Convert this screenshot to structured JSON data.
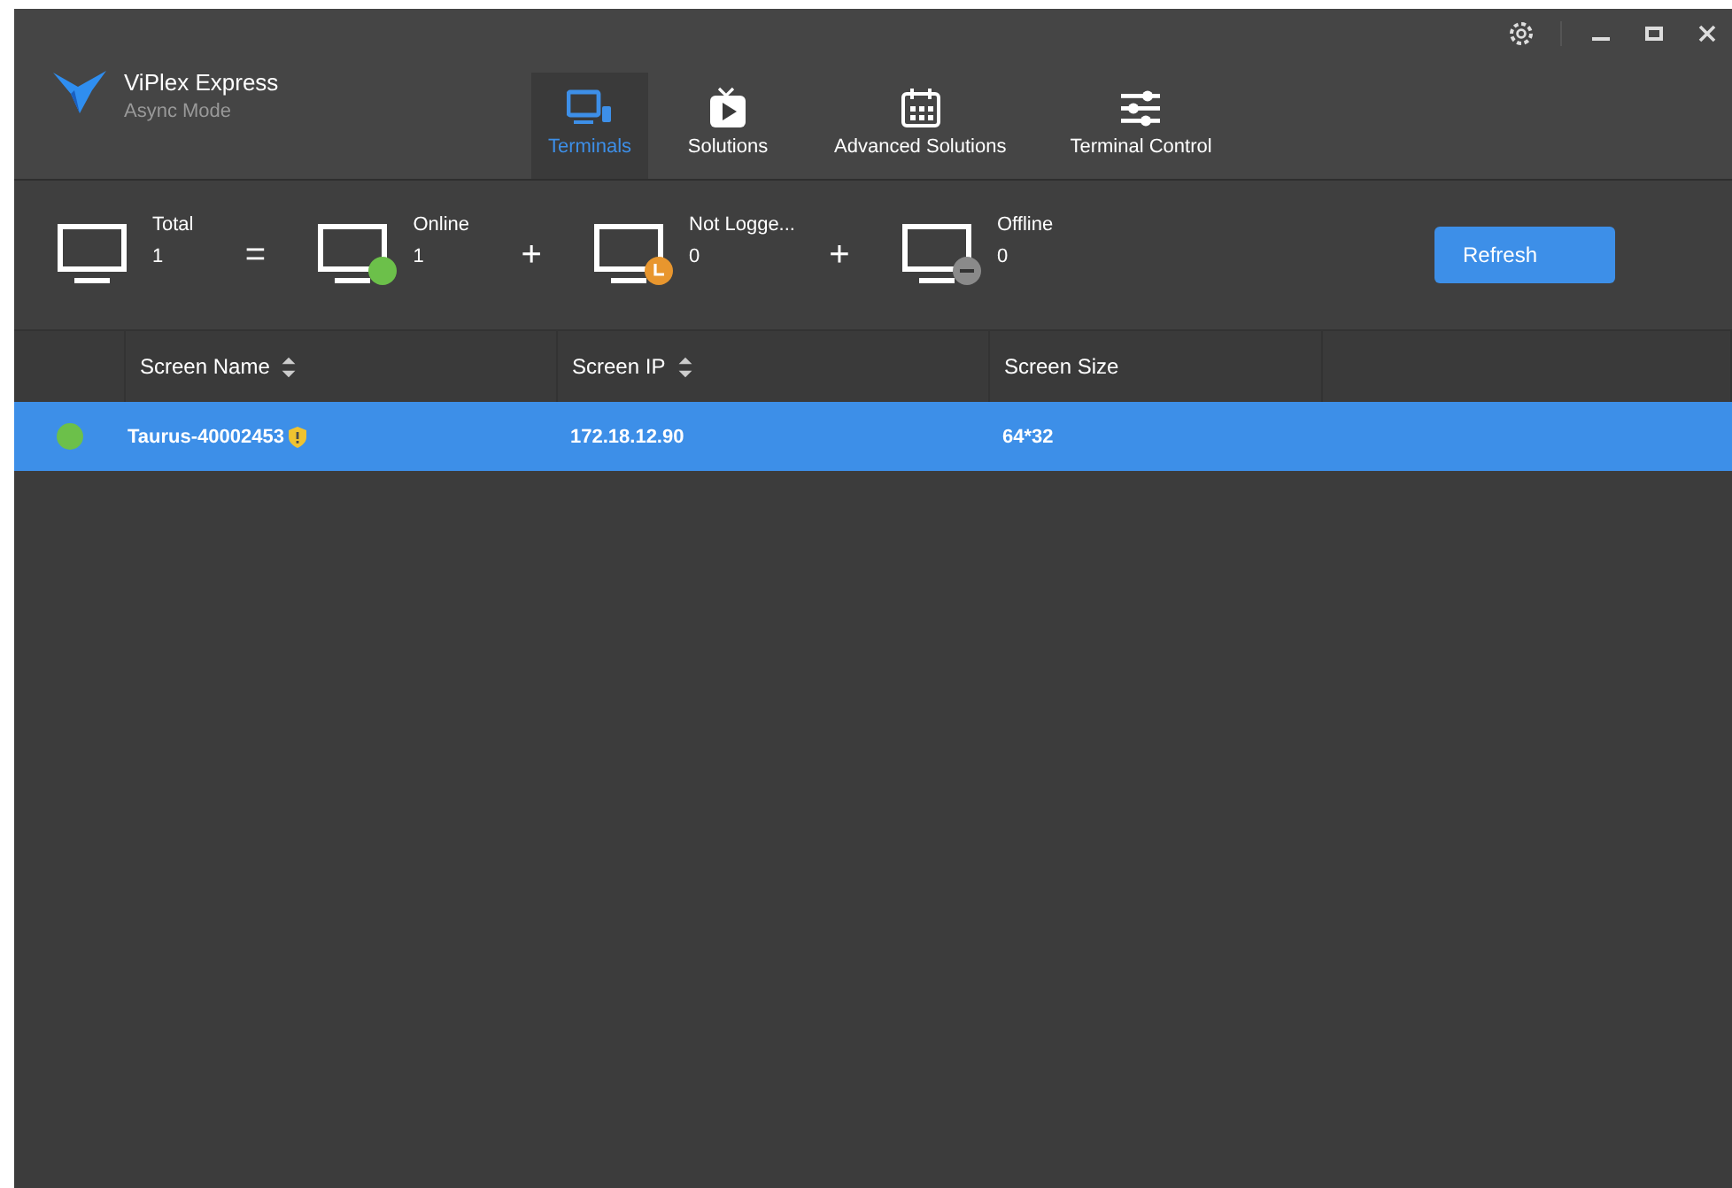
{
  "app": {
    "title": "ViPlex Express",
    "subtitle": "Async Mode"
  },
  "tabs": [
    {
      "label": "Terminals",
      "selected": true
    },
    {
      "label": "Solutions",
      "selected": false
    },
    {
      "label": "Advanced Solutions",
      "selected": false
    },
    {
      "label": "Terminal Control",
      "selected": false
    }
  ],
  "summary": [
    {
      "kind": "total",
      "label": "Total",
      "count": "1"
    },
    {
      "kind": "operator",
      "symbol": "="
    },
    {
      "kind": "online",
      "label": "Online",
      "count": "1"
    },
    {
      "kind": "operator",
      "symbol": "+"
    },
    {
      "kind": "pending",
      "label": "Not Logge...",
      "count": "0"
    },
    {
      "kind": "operator",
      "symbol": "+"
    },
    {
      "kind": "offline",
      "label": "Offline",
      "count": "0"
    }
  ],
  "refresh_button": {
    "label": "Refresh"
  },
  "table": {
    "columns": [
      {
        "label": "Screen Name",
        "sortable": true
      },
      {
        "label": "Screen IP",
        "sortable": true
      },
      {
        "label": "Screen Size",
        "sortable": false
      }
    ],
    "rows": [
      {
        "color": "#6cc04a",
        "name": "Taurus-40002453",
        "ip": "172.18.12.90",
        "size": "64*32",
        "selected": true,
        "secured": true
      }
    ]
  }
}
